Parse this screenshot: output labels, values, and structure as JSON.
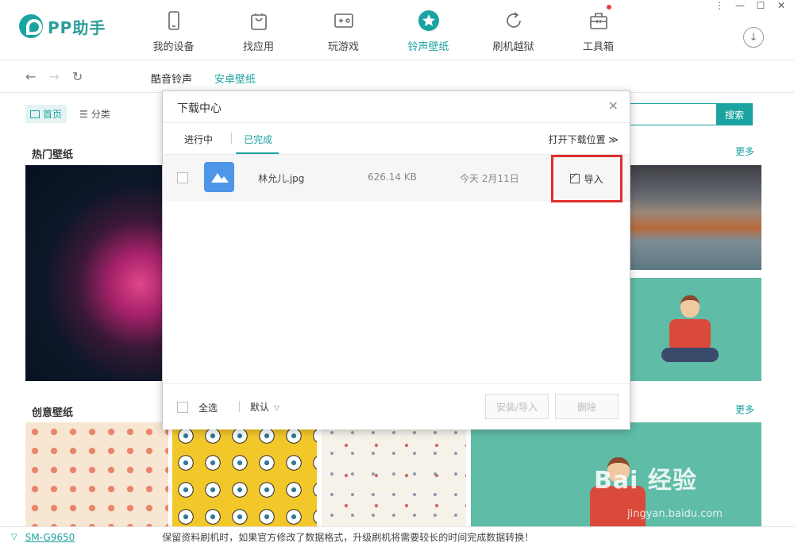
{
  "app": {
    "name": "PP助手"
  },
  "nav": {
    "items": [
      {
        "label": "我的设备",
        "icon": "phone-icon"
      },
      {
        "label": "找应用",
        "icon": "bag-icon"
      },
      {
        "label": "玩游戏",
        "icon": "gamepad-icon"
      },
      {
        "label": "铃声壁纸",
        "icon": "star-icon",
        "active": true
      },
      {
        "label": "刷机越狱",
        "icon": "refresh-icon"
      },
      {
        "label": "工具箱",
        "icon": "toolbox-icon"
      }
    ]
  },
  "subnav": {
    "tabs": [
      "酷音铃声",
      "安卓壁纸"
    ],
    "active": "安卓壁纸"
  },
  "main": {
    "view_tabs": [
      "首页",
      "分类"
    ],
    "search_button": "搜索",
    "section_hot": "热门壁纸",
    "section_creative": "创意壁纸",
    "more": "更多"
  },
  "modal": {
    "title": "下载中心",
    "close": "×",
    "tabs": [
      "进行中",
      "已完成"
    ],
    "active_tab": "已完成",
    "open_location": "打开下载位置 ≫",
    "file": {
      "name": "林允儿.jpg",
      "size": "626.14 KB",
      "date": "今天 2月11日",
      "action": "导入"
    },
    "footer": {
      "select_all": "全选",
      "sort": "默认",
      "install_import": "安装/导入",
      "delete": "删除"
    }
  },
  "statusbar": {
    "device": "SM-G9650",
    "message": "保留资料刷机时，如果官方修改了数据格式，升级刷机将需要较长的时间完成数据转换！"
  },
  "watermark": {
    "brand": "Bai 经验",
    "url": "jingyan.baidu.com"
  },
  "colors": {
    "accent": "#1aa3a0",
    "highlight": "#e0302f"
  }
}
